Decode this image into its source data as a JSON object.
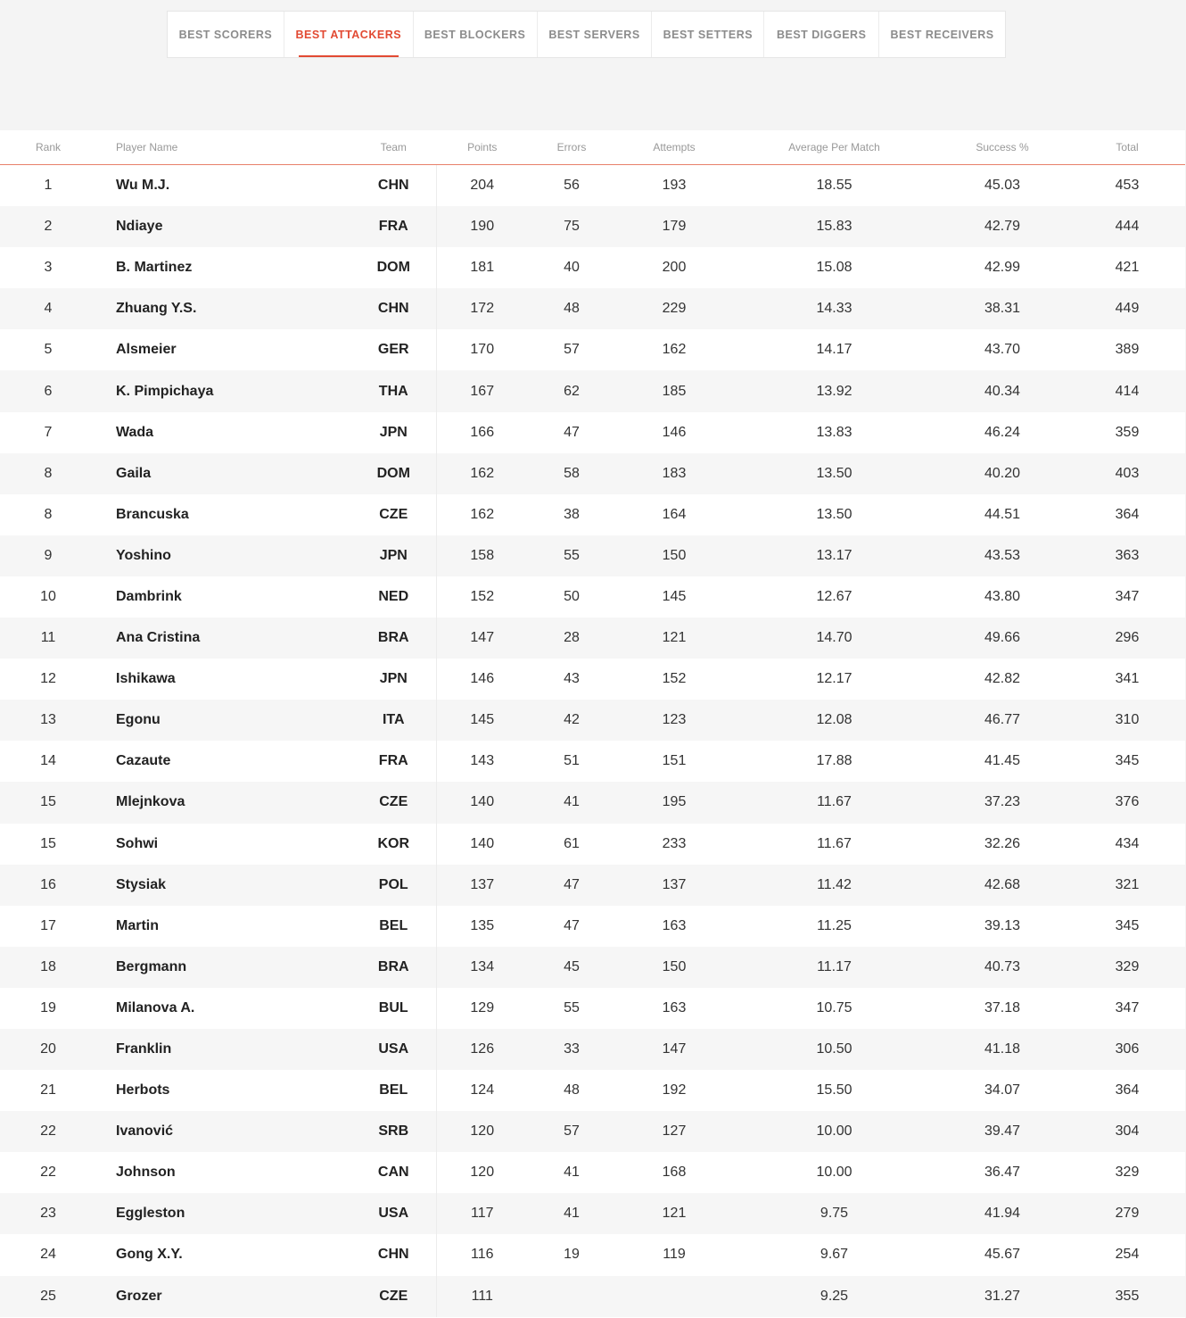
{
  "tabs": [
    {
      "label": "BEST SCORERS",
      "active": false
    },
    {
      "label": "BEST ATTACKERS",
      "active": true
    },
    {
      "label": "BEST BLOCKERS",
      "active": false
    },
    {
      "label": "BEST SERVERS",
      "active": false
    },
    {
      "label": "BEST SETTERS",
      "active": false
    },
    {
      "label": "BEST DIGGERS",
      "active": false
    },
    {
      "label": "BEST RECEIVERS",
      "active": false
    }
  ],
  "accent_color": "#e24a33",
  "table": {
    "headers": [
      "Rank",
      "Player Name",
      "Team",
      "Points",
      "Errors",
      "Attempts",
      "Average Per Match",
      "Success %",
      "Total"
    ],
    "rows": [
      [
        "1",
        "Wu M.J.",
        "CHN",
        "204",
        "56",
        "193",
        "18.55",
        "45.03",
        "453"
      ],
      [
        "2",
        "Ndiaye",
        "FRA",
        "190",
        "75",
        "179",
        "15.83",
        "42.79",
        "444"
      ],
      [
        "3",
        "B. Martinez",
        "DOM",
        "181",
        "40",
        "200",
        "15.08",
        "42.99",
        "421"
      ],
      [
        "4",
        "Zhuang Y.S.",
        "CHN",
        "172",
        "48",
        "229",
        "14.33",
        "38.31",
        "449"
      ],
      [
        "5",
        "Alsmeier",
        "GER",
        "170",
        "57",
        "162",
        "14.17",
        "43.70",
        "389"
      ],
      [
        "6",
        "K. Pimpichaya",
        "THA",
        "167",
        "62",
        "185",
        "13.92",
        "40.34",
        "414"
      ],
      [
        "7",
        "Wada",
        "JPN",
        "166",
        "47",
        "146",
        "13.83",
        "46.24",
        "359"
      ],
      [
        "8",
        "Gaila",
        "DOM",
        "162",
        "58",
        "183",
        "13.50",
        "40.20",
        "403"
      ],
      [
        "8",
        "Brancuska",
        "CZE",
        "162",
        "38",
        "164",
        "13.50",
        "44.51",
        "364"
      ],
      [
        "9",
        "Yoshino",
        "JPN",
        "158",
        "55",
        "150",
        "13.17",
        "43.53",
        "363"
      ],
      [
        "10",
        "Dambrink",
        "NED",
        "152",
        "50",
        "145",
        "12.67",
        "43.80",
        "347"
      ],
      [
        "11",
        "Ana Cristina",
        "BRA",
        "147",
        "28",
        "121",
        "14.70",
        "49.66",
        "296"
      ],
      [
        "12",
        "Ishikawa",
        "JPN",
        "146",
        "43",
        "152",
        "12.17",
        "42.82",
        "341"
      ],
      [
        "13",
        "Egonu",
        "ITA",
        "145",
        "42",
        "123",
        "12.08",
        "46.77",
        "310"
      ],
      [
        "14",
        "Cazaute",
        "FRA",
        "143",
        "51",
        "151",
        "17.88",
        "41.45",
        "345"
      ],
      [
        "15",
        "Mlejnkova",
        "CZE",
        "140",
        "41",
        "195",
        "11.67",
        "37.23",
        "376"
      ],
      [
        "15",
        "Sohwi",
        "KOR",
        "140",
        "61",
        "233",
        "11.67",
        "32.26",
        "434"
      ],
      [
        "16",
        "Stysiak",
        "POL",
        "137",
        "47",
        "137",
        "11.42",
        "42.68",
        "321"
      ],
      [
        "17",
        "Martin",
        "BEL",
        "135",
        "47",
        "163",
        "11.25",
        "39.13",
        "345"
      ],
      [
        "18",
        "Bergmann",
        "BRA",
        "134",
        "45",
        "150",
        "11.17",
        "40.73",
        "329"
      ],
      [
        "19",
        "Milanova A.",
        "BUL",
        "129",
        "55",
        "163",
        "10.75",
        "37.18",
        "347"
      ],
      [
        "20",
        "Franklin",
        "USA",
        "126",
        "33",
        "147",
        "10.50",
        "41.18",
        "306"
      ],
      [
        "21",
        "Herbots",
        "BEL",
        "124",
        "48",
        "192",
        "15.50",
        "34.07",
        "364"
      ],
      [
        "22",
        "Ivanović",
        "SRB",
        "120",
        "57",
        "127",
        "10.00",
        "39.47",
        "304"
      ],
      [
        "22",
        "Johnson",
        "CAN",
        "120",
        "41",
        "168",
        "10.00",
        "36.47",
        "329"
      ],
      [
        "23",
        "Eggleston",
        "USA",
        "117",
        "41",
        "121",
        "9.75",
        "41.94",
        "279"
      ],
      [
        "24",
        "Gong X.Y.",
        "CHN",
        "116",
        "19",
        "119",
        "9.67",
        "45.67",
        "254"
      ],
      [
        "25",
        "Grozer",
        "CZE",
        "111",
        "",
        "",
        "9.25",
        "31.27",
        "355"
      ]
    ]
  }
}
